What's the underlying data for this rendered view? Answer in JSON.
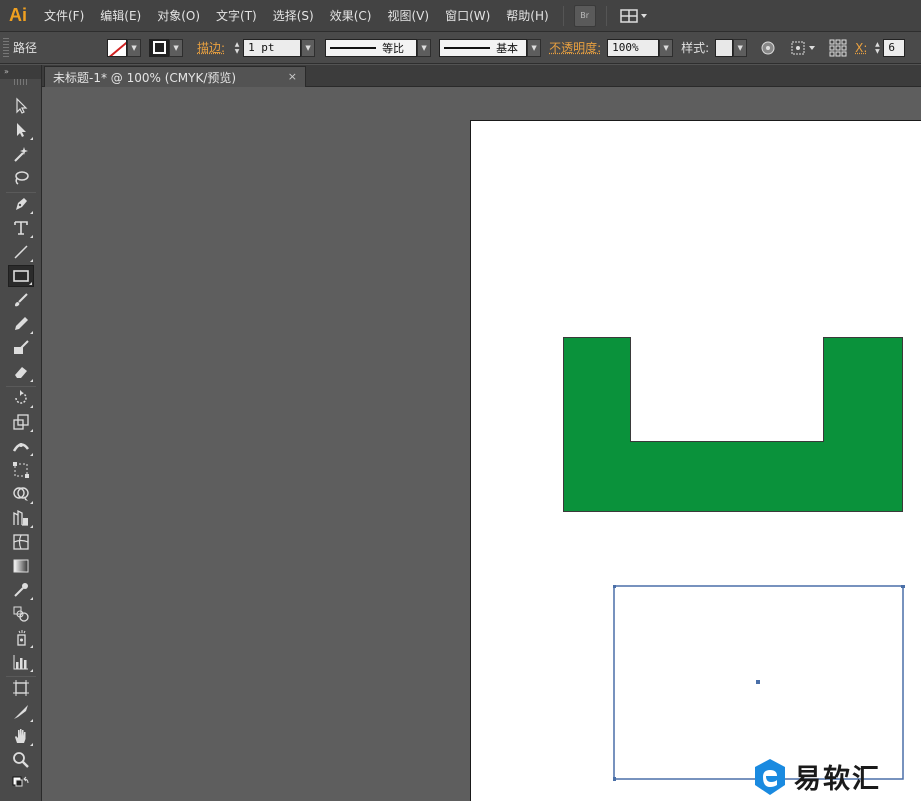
{
  "app": {
    "logo": "Ai",
    "accent_color": "#f0a020"
  },
  "menu": {
    "items": [
      {
        "name": "file",
        "label": "文件(F)"
      },
      {
        "name": "edit",
        "label": "编辑(E)"
      },
      {
        "name": "object",
        "label": "对象(O)"
      },
      {
        "name": "type",
        "label": "文字(T)"
      },
      {
        "name": "select",
        "label": "选择(S)"
      },
      {
        "name": "effect",
        "label": "效果(C)"
      },
      {
        "name": "view",
        "label": "视图(V)"
      },
      {
        "name": "window",
        "label": "窗口(W)"
      },
      {
        "name": "help",
        "label": "帮助(H)"
      }
    ],
    "bridge_label": "Br"
  },
  "control": {
    "object_type": "路径",
    "stroke_label": "描边:",
    "stroke_weight": "1 pt",
    "profile_label": "等比",
    "brush_label": "基本",
    "opacity_label": "不透明度:",
    "opacity_value": "100%",
    "style_label": "样式:",
    "x_label": "X:",
    "x_value": "6"
  },
  "document": {
    "tab_title": "未标题-1* @ 100% (CMYK/预览)",
    "close_glyph": "×"
  },
  "artwork": {
    "fill_color": "#0a923b",
    "selection_color": "#4a6fa8"
  },
  "watermark": {
    "text": "易软汇"
  }
}
